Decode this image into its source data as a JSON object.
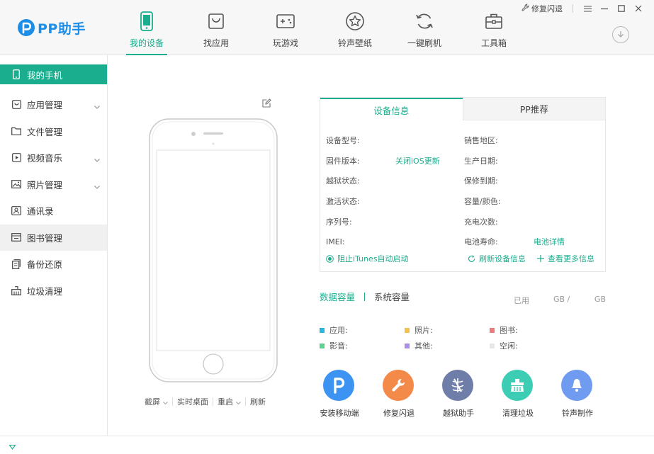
{
  "app": {
    "title": "PP助手",
    "accent": "#1aad8e",
    "brand": "#1c8ee8"
  },
  "nav": {
    "items": [
      {
        "label": "我的设备",
        "icon": "phone-icon",
        "active": true
      },
      {
        "label": "找应用",
        "icon": "shopping-bag-icon"
      },
      {
        "label": "玩游戏",
        "icon": "gamepad-icon"
      },
      {
        "label": "铃声壁纸",
        "icon": "star-icon"
      },
      {
        "label": "一键刷机",
        "icon": "refresh-icon"
      },
      {
        "label": "工具箱",
        "icon": "toolbox-icon"
      }
    ]
  },
  "window": {
    "repair_label": "修复闪退"
  },
  "sidebar": {
    "items": [
      {
        "label": "我的手机",
        "icon": "phone-icon",
        "active": true
      },
      {
        "label": "应用管理",
        "icon": "app-icon",
        "expandable": true
      },
      {
        "label": "文件管理",
        "icon": "folder-icon"
      },
      {
        "label": "视频音乐",
        "icon": "play-icon",
        "expandable": true
      },
      {
        "label": "照片管理",
        "icon": "image-icon",
        "expandable": true
      },
      {
        "label": "通讯录",
        "icon": "contacts-icon"
      },
      {
        "label": "图书管理",
        "icon": "book-icon",
        "hover": true
      },
      {
        "label": "备份还原",
        "icon": "backup-icon"
      },
      {
        "label": "垃圾清理",
        "icon": "broom-icon"
      }
    ]
  },
  "phone_actions": {
    "screenshot": "截屏",
    "live_desktop": "实时桌面",
    "restart": "重启",
    "refresh": "刷新"
  },
  "info": {
    "tabs": [
      "设备信息",
      "PP推荐"
    ],
    "rows": [
      [
        {
          "k": "设备型号:",
          "v": ""
        },
        {
          "k": "销售地区:",
          "v": ""
        }
      ],
      [
        {
          "k": "固件版本:",
          "v": "关闭iOS更新",
          "link": true
        },
        {
          "k": "生产日期:",
          "v": ""
        }
      ],
      [
        {
          "k": "越狱状态:",
          "v": ""
        },
        {
          "k": "保修到期:",
          "v": ""
        }
      ],
      [
        {
          "k": "激活状态:",
          "v": ""
        },
        {
          "k": "容量/颜色:",
          "v": ""
        }
      ],
      [
        {
          "k": "序列号:",
          "v": ""
        },
        {
          "k": "充电次数:",
          "v": ""
        }
      ],
      [
        {
          "k": "IMEI:",
          "v": ""
        },
        {
          "k": "电池寿命:",
          "v": "电池详情",
          "link": true
        }
      ]
    ],
    "block_itunes": "阻止iTunes自动启动",
    "refresh_info": "刷新设备信息",
    "more_info": "查看更多信息"
  },
  "capacity": {
    "tab_data": "数据容量",
    "tab_system": "系统容量",
    "used_label": "已用",
    "unit1": "GB /",
    "unit2": "GB",
    "legend": [
      [
        {
          "label": "应用:",
          "color": "#27b8e0"
        },
        {
          "label": "照片:",
          "color": "#f5c34d"
        },
        {
          "label": "图书:",
          "color": "#ef7a7e"
        }
      ],
      [
        {
          "label": "影音:",
          "color": "#5fd08f"
        },
        {
          "label": "其他:",
          "color": "#a98de6"
        },
        {
          "label": "空闲:",
          "color": "#e8e8e8"
        }
      ]
    ]
  },
  "tools": [
    {
      "label": "安装移动端",
      "icon": "pp-logo-icon",
      "color": "#3d93f2"
    },
    {
      "label": "修复闪退",
      "icon": "wrench-icon",
      "color": "#f38a4a"
    },
    {
      "label": "越狱助手",
      "icon": "jailbreak-icon",
      "color": "#6f7ea8"
    },
    {
      "label": "清理垃圾",
      "icon": "broom-icon",
      "color": "#3ccdb4"
    },
    {
      "label": "铃声制作",
      "icon": "bell-icon",
      "color": "#6f9bf0"
    }
  ]
}
